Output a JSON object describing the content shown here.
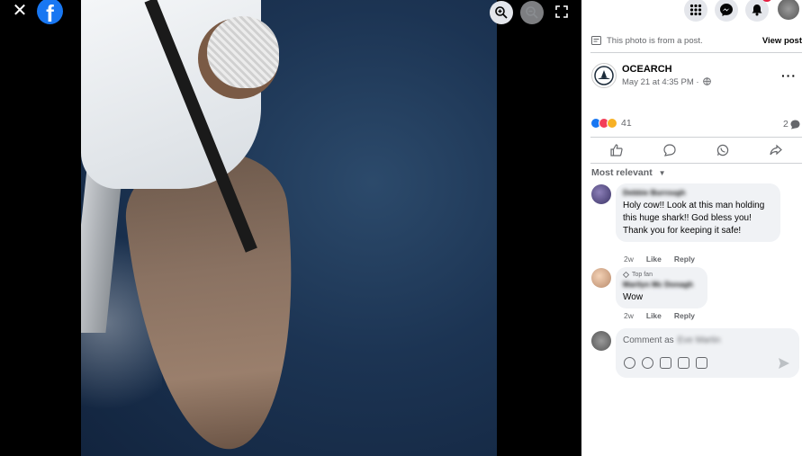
{
  "viewer": {
    "close_icon": "close-icon",
    "logo": "f",
    "zoom_in_icon": "zoom-in-icon",
    "zoom_out_icon": "zoom-out-icon",
    "fullscreen_icon": "expand-icon"
  },
  "topbar": {
    "menu_icon": "grid-menu-icon",
    "messenger_icon": "messenger-icon",
    "notifications_icon": "bell-icon"
  },
  "post": {
    "notice": "This photo is from a post.",
    "view_post": "View post",
    "page_name": "OCEARCH",
    "date": "May 21 at 4:35 PM ·",
    "more": "···",
    "reaction_count": "41",
    "comment_count": "2",
    "sort_label": "Most relevant",
    "colors": {
      "like": "#1877f2",
      "love": "#f33e58",
      "wow": "#f7b125"
    }
  },
  "comments": [
    {
      "author": "Debbie Burrough",
      "text": "Holy cow!! Look at this man holding this huge shark!! God bless you! Thank you for keeping it safe!",
      "time": "2w",
      "like": "Like",
      "reply": "Reply"
    },
    {
      "badge": "Top fan",
      "author": "Marilyn Mc Donagh",
      "text": "Wow",
      "time": "2w",
      "like": "Like",
      "reply": "Reply"
    }
  ],
  "composer": {
    "placeholder": "Comment as",
    "name": "Eve Martin"
  }
}
